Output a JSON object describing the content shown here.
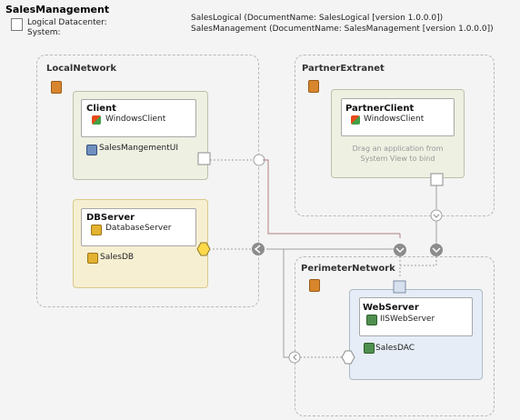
{
  "diagram": {
    "title": "SalesManagement",
    "meta": {
      "label_1": "Logical Datacenter:",
      "label_2": "System:",
      "value_1": "SalesLogical (DocumentName: SalesLogical [version 1.0.0.0])",
      "value_2": "SalesManagement (DocumentName: SalesManagement [version 1.0.0.0])"
    },
    "zones": {
      "local": {
        "label": "LocalNetwork"
      },
      "partner": {
        "label": "PartnerExtranet"
      },
      "perimeter": {
        "label": "PerimeterNetwork"
      }
    },
    "hosts": {
      "client": {
        "title": "Client",
        "type": "WindowsClient",
        "app": "SalesMangementUI"
      },
      "dbserver": {
        "title": "DBServer",
        "type": "DatabaseServer",
        "app": "SalesDB"
      },
      "partnerclient": {
        "title": "PartnerClient",
        "type": "WindowsClient",
        "hint": "Drag an application from System View to bind"
      },
      "webserver": {
        "title": "WebServer",
        "type": "IISWebServer",
        "app": "SalesDAC"
      }
    },
    "colors": {
      "zone_icon": "#d8862d",
      "connector": "#a0a0a0",
      "db_host": "#f7efd2",
      "web_host": "#e6edf6",
      "client_host": "#eef0e2"
    }
  }
}
